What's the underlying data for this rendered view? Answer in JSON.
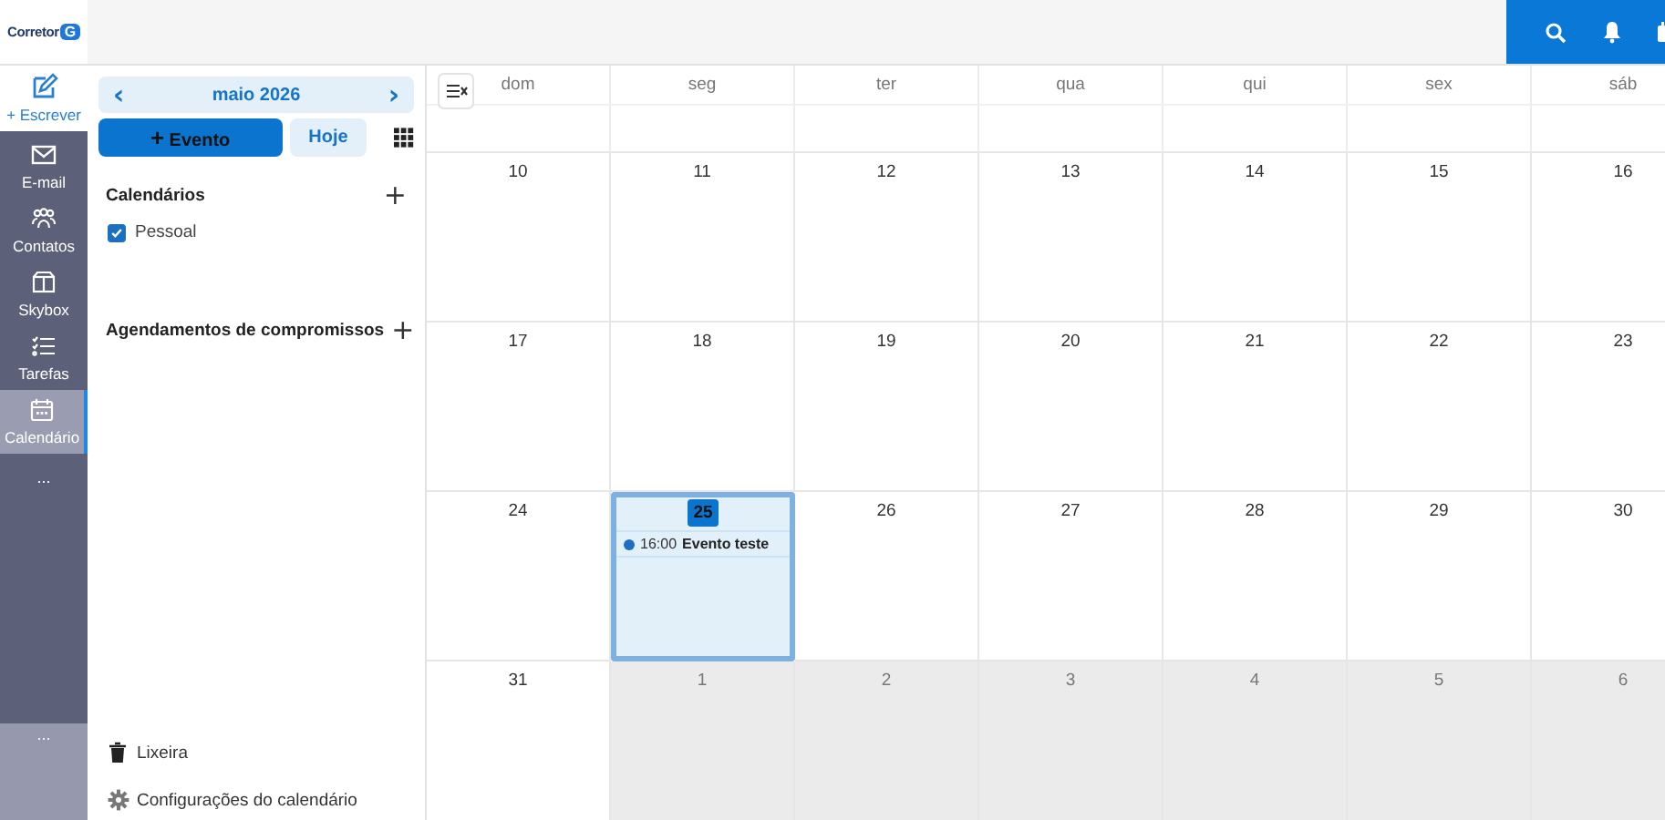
{
  "logo": {
    "text": "Corretor",
    "mark": "G"
  },
  "rail": {
    "compose": {
      "label": "+ Escrever"
    },
    "items": [
      {
        "label": "E-mail",
        "selected": false
      },
      {
        "label": "Contatos",
        "selected": false
      },
      {
        "label": "Skybox",
        "selected": false
      },
      {
        "label": "Tarefas",
        "selected": false
      },
      {
        "label": "Calendário",
        "selected": true
      }
    ],
    "more": "...",
    "bottom_more": "..."
  },
  "sidebar": {
    "month": "maio 2026",
    "prev": "‹",
    "next": "›",
    "new_event": {
      "icon": "+",
      "label": "Evento"
    },
    "today": "Hoje",
    "sections": [
      {
        "title": "Calendários",
        "add": "+",
        "items": [
          {
            "label": "Pessoal",
            "checked": true
          }
        ]
      },
      {
        "title": "Agendamentos de compromissos",
        "add": "+"
      }
    ],
    "footer": [
      {
        "label": "Lixeira"
      },
      {
        "label": "Configurações do calendário"
      }
    ]
  },
  "calendar": {
    "weekdays": [
      "dom",
      "seg",
      "ter",
      "qua",
      "qui",
      "sex",
      "sáb"
    ],
    "weeks": [
      {
        "days": [
          {
            "day": "10",
            "other_month": false,
            "today": false,
            "selected": false
          },
          {
            "day": "11",
            "other_month": false,
            "today": false,
            "selected": false
          },
          {
            "day": "12",
            "other_month": false,
            "today": false,
            "selected": false
          },
          {
            "day": "13",
            "other_month": false,
            "today": false,
            "selected": false
          },
          {
            "day": "14",
            "other_month": false,
            "today": false,
            "selected": false
          },
          {
            "day": "15",
            "other_month": false,
            "today": false,
            "selected": false
          },
          {
            "day": "16",
            "other_month": false,
            "today": false,
            "selected": false
          }
        ]
      },
      {
        "days": [
          {
            "day": "17",
            "other_month": false,
            "today": false,
            "selected": false
          },
          {
            "day": "18",
            "other_month": false,
            "today": false,
            "selected": false
          },
          {
            "day": "19",
            "other_month": false,
            "today": false,
            "selected": false
          },
          {
            "day": "20",
            "other_month": false,
            "today": false,
            "selected": false
          },
          {
            "day": "21",
            "other_month": false,
            "today": false,
            "selected": false
          },
          {
            "day": "22",
            "other_month": false,
            "today": false,
            "selected": false
          },
          {
            "day": "23",
            "other_month": false,
            "today": false,
            "selected": false
          }
        ]
      },
      {
        "days": [
          {
            "day": "24",
            "other_month": false,
            "today": false,
            "selected": false
          },
          {
            "day": "25",
            "other_month": false,
            "today": true,
            "selected": true,
            "events": [
              {
                "time": "16:00",
                "title": "Evento teste",
                "color": "#1e6fc2"
              }
            ]
          },
          {
            "day": "26",
            "other_month": false,
            "today": false,
            "selected": false
          },
          {
            "day": "27",
            "other_month": false,
            "today": false,
            "selected": false
          },
          {
            "day": "28",
            "other_month": false,
            "today": false,
            "selected": false
          },
          {
            "day": "29",
            "other_month": false,
            "today": false,
            "selected": false
          },
          {
            "day": "30",
            "other_month": false,
            "today": false,
            "selected": false
          }
        ]
      },
      {
        "days": [
          {
            "day": "31",
            "other_month": false,
            "today": false,
            "selected": false
          },
          {
            "day": "1",
            "other_month": true,
            "today": false,
            "selected": false
          },
          {
            "day": "2",
            "other_month": true,
            "today": false,
            "selected": false
          },
          {
            "day": "3",
            "other_month": true,
            "today": false,
            "selected": false
          },
          {
            "day": "4",
            "other_month": true,
            "today": false,
            "selected": false
          },
          {
            "day": "5",
            "other_month": true,
            "today": false,
            "selected": false
          },
          {
            "day": "6",
            "other_month": true,
            "today": false,
            "selected": false
          }
        ]
      }
    ]
  }
}
